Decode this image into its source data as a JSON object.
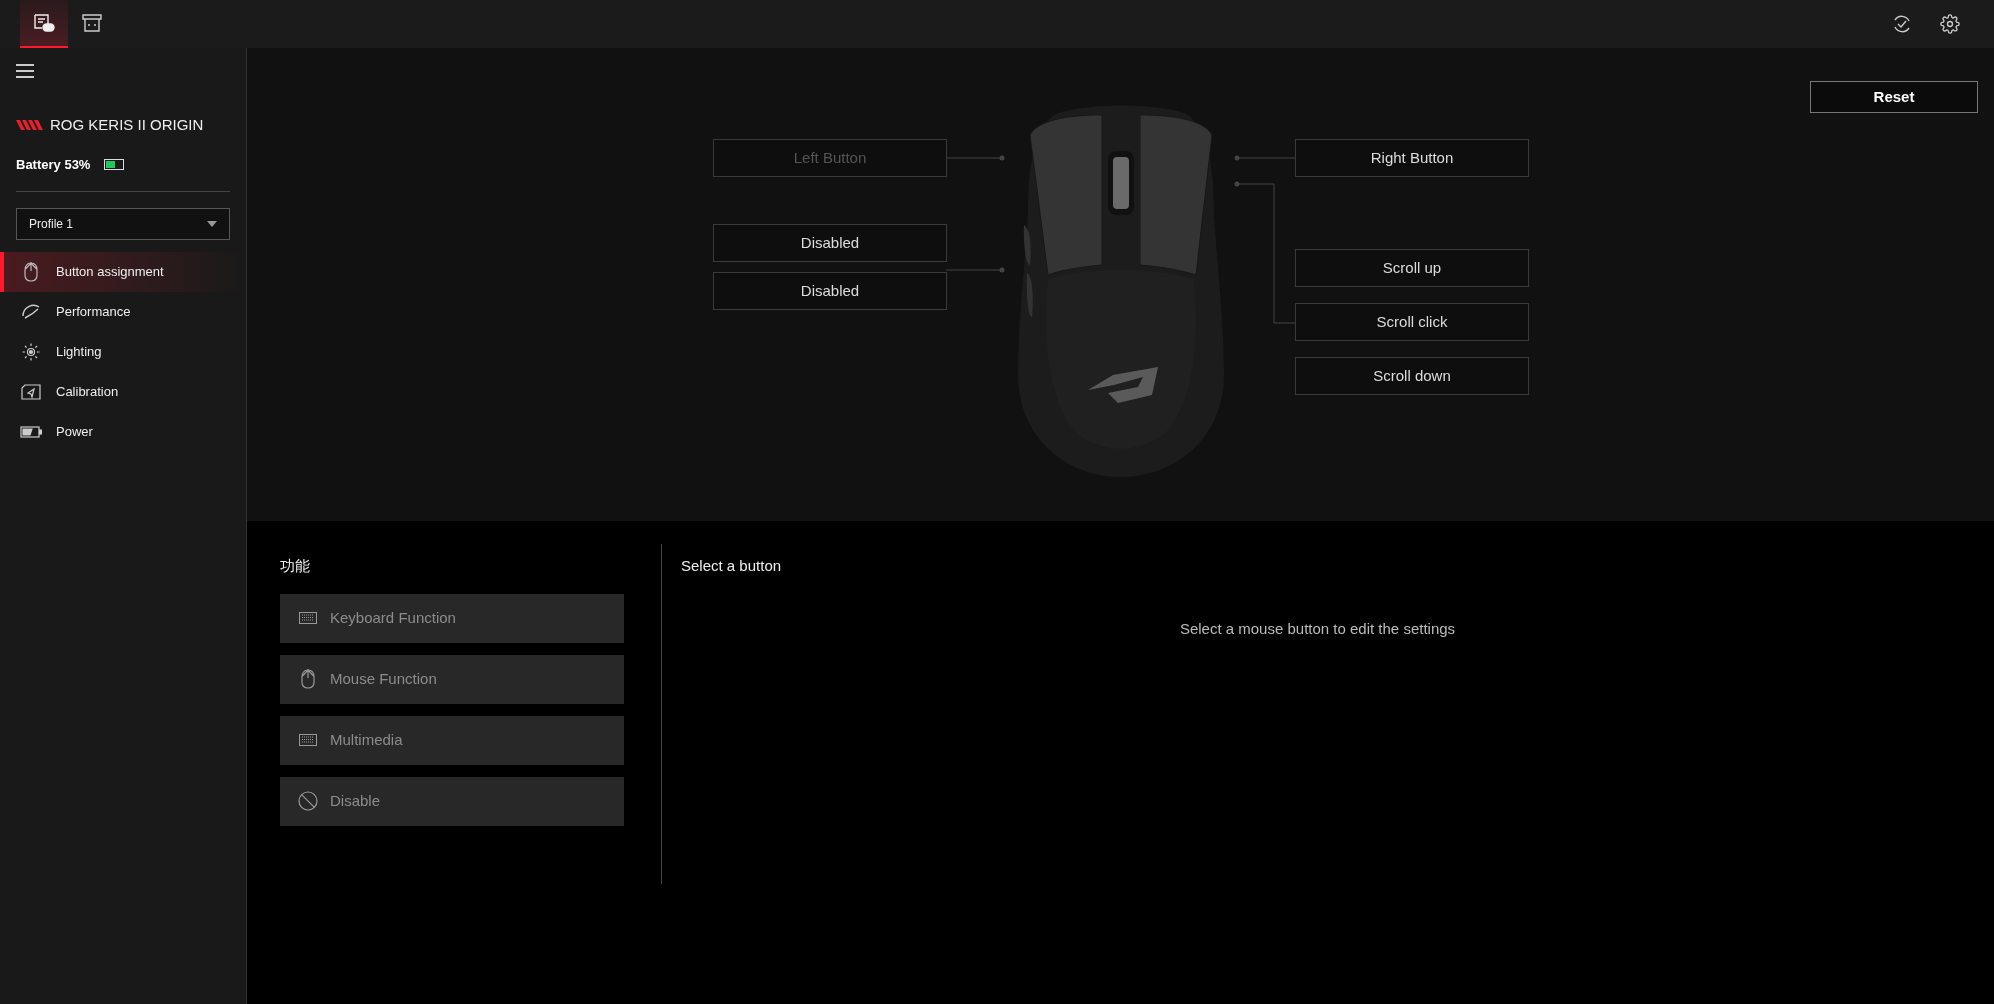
{
  "top_tabs": [
    {
      "kind": "device",
      "selected": true
    },
    {
      "kind": "dongle",
      "selected": false
    }
  ],
  "device": {
    "name": "ROG KERIS II ORIGIN",
    "battery_label": "Battery 53%",
    "level": 0.53
  },
  "profile": {
    "value": "Profile 1"
  },
  "nav": [
    {
      "kind": "mouse",
      "label": "Button assignment",
      "selected": true
    },
    {
      "kind": "performance",
      "label": "Performance",
      "selected": false
    },
    {
      "kind": "lighting",
      "label": "Lighting",
      "selected": false
    },
    {
      "kind": "calibration",
      "label": "Calibration",
      "selected": false
    },
    {
      "kind": "power",
      "label": "Power",
      "selected": false
    }
  ],
  "reset_button": "Reset",
  "assignments": [
    {
      "kind": "left",
      "label": "Left Button",
      "dimmed": true
    },
    {
      "kind": "sidefront",
      "label": "Disabled",
      "dimmed": false
    },
    {
      "kind": "sideback",
      "label": "Disabled",
      "dimmed": false
    },
    {
      "kind": "right",
      "label": "Right Button",
      "dimmed": false
    },
    {
      "kind": "scrollup",
      "label": "Scroll up",
      "dimmed": false
    },
    {
      "kind": "scrollclick",
      "label": "Scroll click",
      "dimmed": false
    },
    {
      "kind": "scrolldown",
      "label": "Scroll down",
      "dimmed": false
    }
  ],
  "functions": {
    "title": "功能",
    "items": [
      {
        "kind": "keyboard",
        "label": "Keyboard Function"
      },
      {
        "kind": "mouse",
        "label": "Mouse Function"
      },
      {
        "kind": "keyboard",
        "label": "Multimedia"
      },
      {
        "kind": "disable",
        "label": "Disable"
      }
    ]
  },
  "detail": {
    "title": "Select a button",
    "message": "Select a mouse button to edit the settings"
  }
}
